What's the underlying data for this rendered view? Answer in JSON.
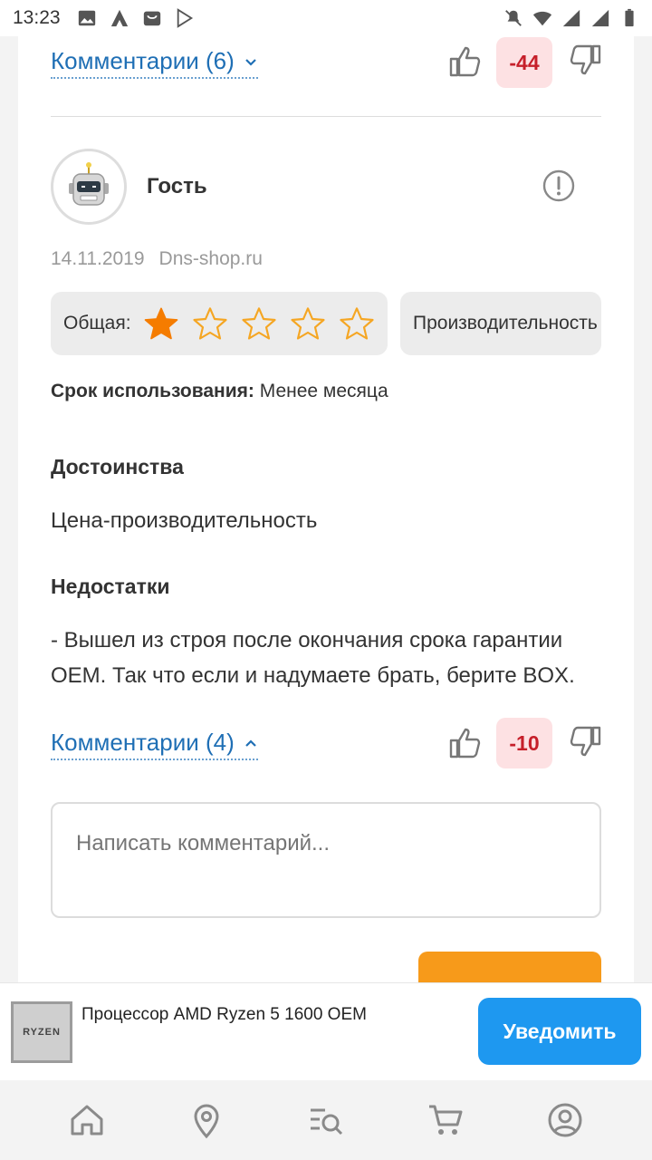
{
  "status_bar": {
    "time": "13:23"
  },
  "review_prev": {
    "comments_label": "Комментарии (6)",
    "score": "-44"
  },
  "review": {
    "author": "Гость",
    "date": "14.11.2019",
    "source": "Dns-shop.ru",
    "overall_label": "Общая:",
    "overall_rating": 1,
    "overall_max": 5,
    "performance_label": "Производительность",
    "usage_label": "Срок использования:",
    "usage_value": "Менее месяца",
    "pros_title": "Достоинства",
    "pros_text": "Цена-производительность",
    "cons_title": "Недостатки",
    "cons_text": "- Вышел из строя после окончания срока гарантии OEM. Так что если и надумаете брать, берите BOX.",
    "comments_label": "Комментарии (4)",
    "score": "-10",
    "comment_placeholder": "Написать комментарий..."
  },
  "product_bar": {
    "name": "Процессор AMD Ryzen 5 1600 OEM",
    "thumb_text": "RYZEN",
    "notify_label": "Уведомить"
  },
  "colors": {
    "accent_blue": "#1e98f0",
    "link_blue": "#1f6fb5",
    "star_orange": "#f57c00",
    "score_red": "#c61f2a"
  },
  "bottom_nav": [
    "home-icon",
    "location-icon",
    "catalog-search-icon",
    "cart-icon",
    "profile-icon"
  ]
}
